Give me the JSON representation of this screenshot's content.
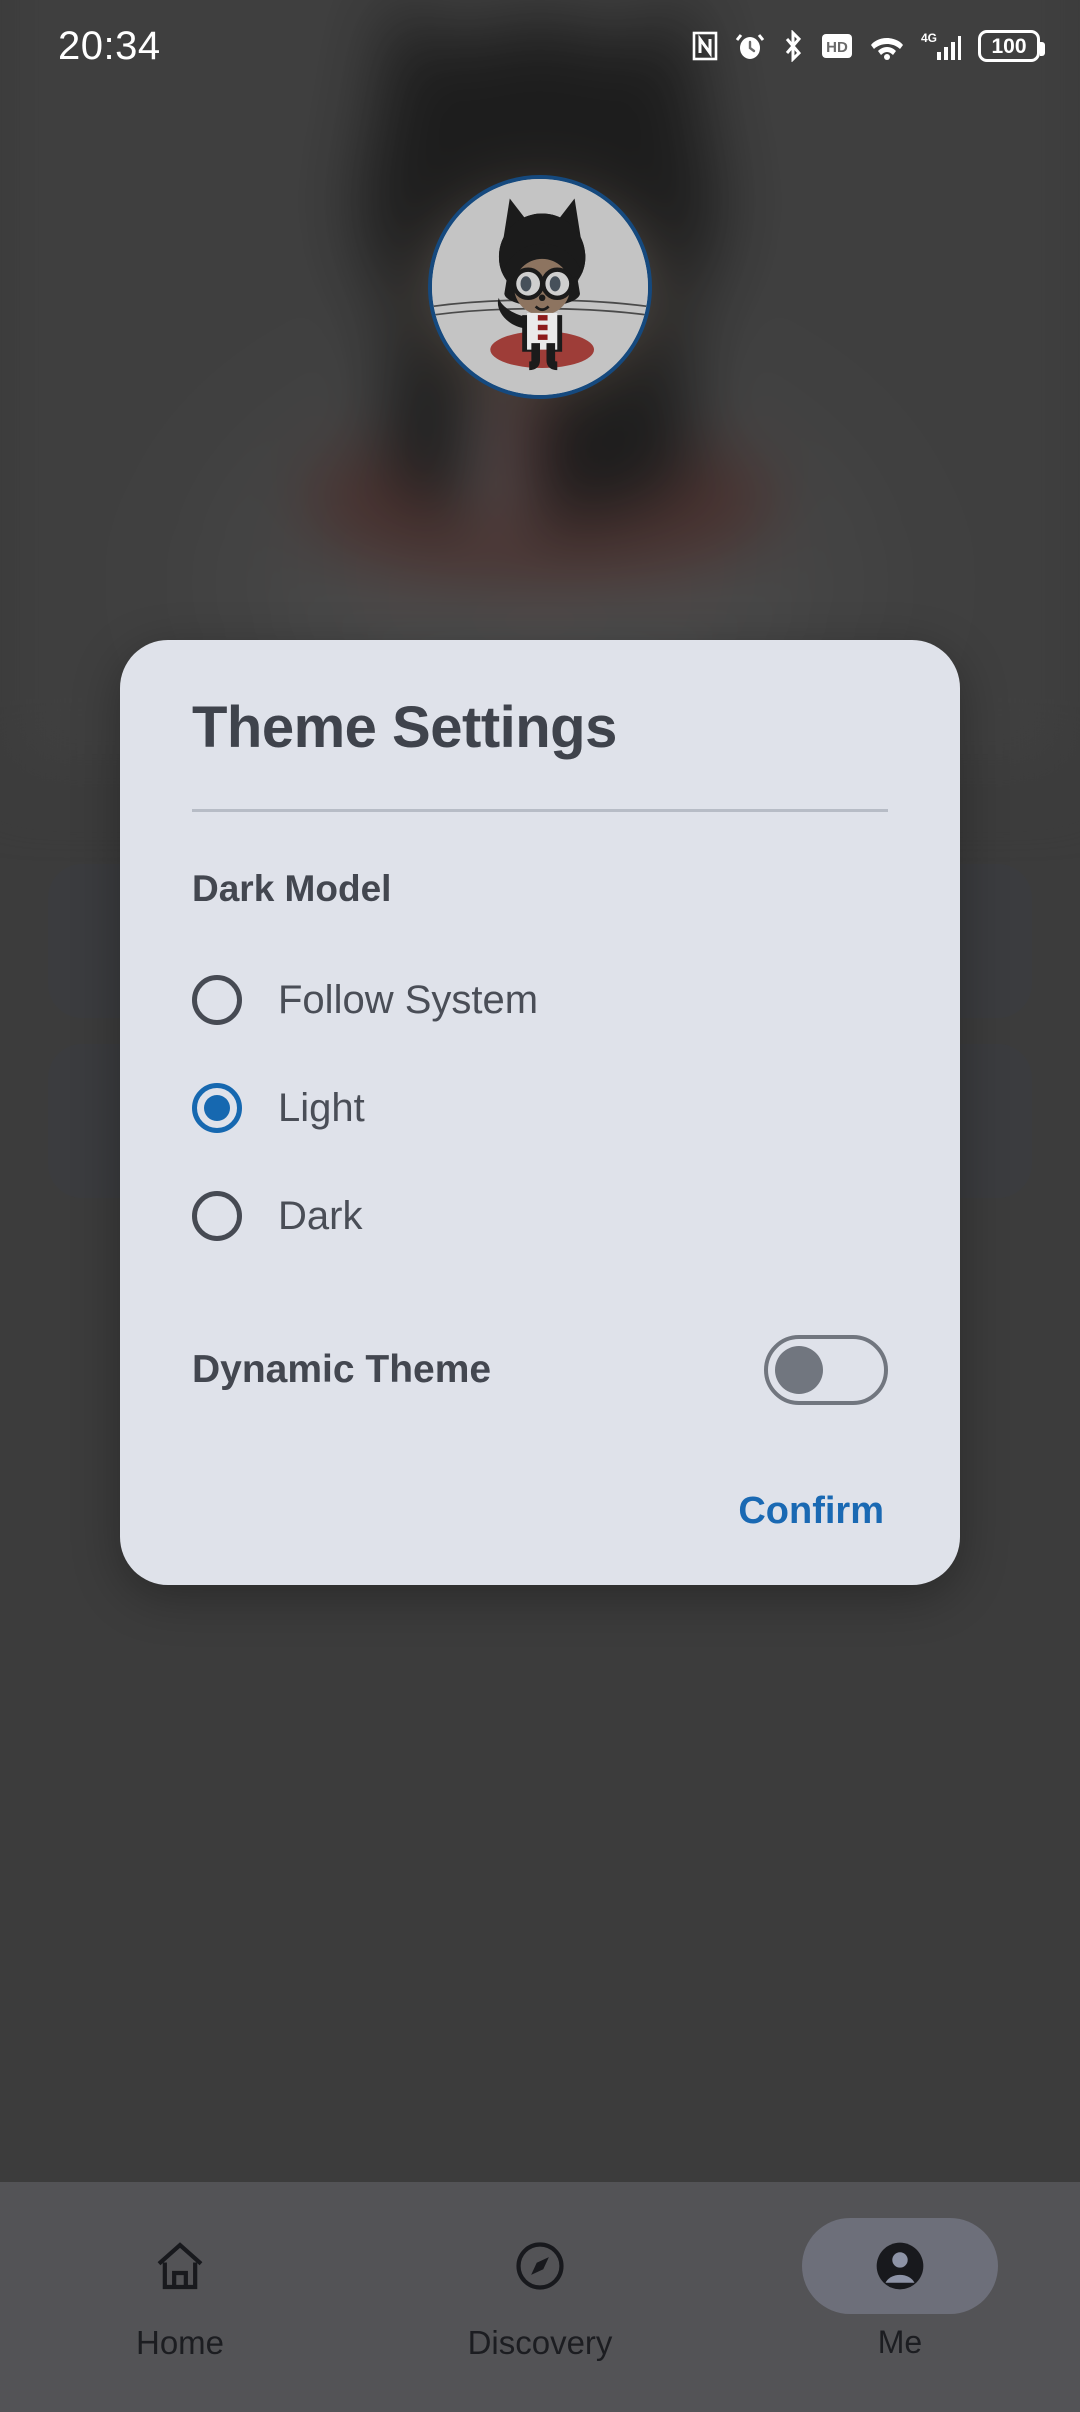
{
  "status_bar": {
    "time": "20:34",
    "battery_level": "100",
    "icons": [
      "nfc-icon",
      "alarm-icon",
      "bluetooth-icon",
      "hd-icon",
      "wifi-icon",
      "4g-icon",
      "signal-icon",
      "battery-icon"
    ],
    "network_type": "4G"
  },
  "profile": {
    "avatar_name": "octocat-avatar",
    "avatar_border_color": "#15497e"
  },
  "dialog": {
    "title": "Theme Settings",
    "section_label": "Dark Model",
    "radio_options": [
      {
        "label": "Follow System",
        "selected": false
      },
      {
        "label": "Light",
        "selected": true
      },
      {
        "label": "Dark",
        "selected": false
      }
    ],
    "toggle": {
      "label": "Dynamic Theme",
      "enabled": false
    },
    "confirm_label": "Confirm",
    "background_color": "#dfe2ea",
    "accent_color": "#1668b0",
    "title_color": "#3f434c"
  },
  "bottom_nav": {
    "items": [
      {
        "label": "Home",
        "icon": "home-icon",
        "active": false
      },
      {
        "label": "Discovery",
        "icon": "compass-icon",
        "active": false
      },
      {
        "label": "Me",
        "icon": "person-icon",
        "active": true
      }
    ]
  },
  "background_cards": [
    {
      "icon": "palette-icon"
    },
    {
      "icon": "device-icon"
    }
  ]
}
